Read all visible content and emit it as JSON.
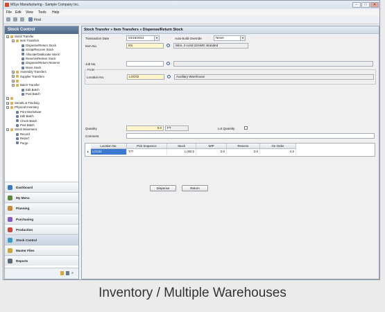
{
  "window": {
    "title": "MSys Manufacturing - Sample Company Inc.",
    "controls": [
      "–",
      "□",
      "✕"
    ]
  },
  "menu": [
    "File",
    "Edit",
    "View",
    "Tools",
    "Help"
  ],
  "toolbar": {
    "find_label": "Find"
  },
  "sidebar": {
    "header": "Stock Control",
    "tree": [
      {
        "label": "Stock Transfer",
        "lvl": 0,
        "exp": "−",
        "kind": "folder"
      },
      {
        "label": "Item Transfers",
        "lvl": 1,
        "exp": "−",
        "kind": "folder"
      },
      {
        "label": "Dispense/Return Stock",
        "lvl": 2,
        "kind": "leaf"
      },
      {
        "label": "Scrap/Recover Stock",
        "lvl": 2,
        "kind": "leaf"
      },
      {
        "label": "Allocate/Deallocate Stock",
        "lvl": 2,
        "kind": "leaf"
      },
      {
        "label": "Reserve/Relieve Stock",
        "lvl": 2,
        "kind": "leaf"
      },
      {
        "label": "Dispense/Return Reserve",
        "lvl": 2,
        "kind": "leaf"
      },
      {
        "label": "Move Stock",
        "lvl": 2,
        "kind": "leaf"
      },
      {
        "label": "Assembly Transfers",
        "lvl": 1,
        "exp": "+",
        "kind": "folder"
      },
      {
        "label": "Supplier Transfers",
        "lvl": 1,
        "exp": "+",
        "kind": "folder"
      },
      {
        "label": "",
        "lvl": 1,
        "exp": "+",
        "kind": "folder"
      },
      {
        "label": "Batch Transfer",
        "lvl": 1,
        "exp": "−",
        "kind": "folder"
      },
      {
        "label": "Edit Batch",
        "lvl": 2,
        "kind": "leaf"
      },
      {
        "label": "Post Batch",
        "lvl": 2,
        "kind": "leaf"
      },
      {
        "label": "",
        "lvl": 0,
        "exp": "+",
        "kind": "folder"
      },
      {
        "label": "Serial/Lot Tracking",
        "lvl": 0,
        "exp": "+",
        "kind": "folder"
      },
      {
        "label": "Physical Inventory",
        "lvl": 0,
        "exp": "−",
        "kind": "folder"
      },
      {
        "label": "Print Worksheet",
        "lvl": 1,
        "kind": "leaf"
      },
      {
        "label": "Edit Batch",
        "lvl": 1,
        "kind": "leaf"
      },
      {
        "label": "Check Batch",
        "lvl": 1,
        "kind": "leaf"
      },
      {
        "label": "Post Batch",
        "lvl": 1,
        "kind": "leaf"
      },
      {
        "label": "Stock Movement",
        "lvl": 0,
        "exp": "−",
        "kind": "folder"
      },
      {
        "label": "Record",
        "lvl": 1,
        "kind": "leaf"
      },
      {
        "label": "Report",
        "lvl": 1,
        "kind": "leaf"
      },
      {
        "label": "Purge",
        "lvl": 1,
        "kind": "leaf"
      }
    ],
    "nav": [
      {
        "label": "Dashboard",
        "color": "#3a78c9"
      },
      {
        "label": "My Menu",
        "color": "#5a8a3a"
      },
      {
        "label": "Planning",
        "color": "#c9873a"
      },
      {
        "label": "Purchasing",
        "color": "#8a5ac9"
      },
      {
        "label": "Production",
        "color": "#c94a3a"
      },
      {
        "label": "Stock Control",
        "color": "#3a9ac9"
      },
      {
        "label": "Master Files",
        "color": "#c9a93a"
      },
      {
        "label": "Reports",
        "color": "#5a6a7a"
      }
    ],
    "active_nav": 5
  },
  "main": {
    "breadcrumb": "Stock Transfer » Item Transfers » Dispense/Return Stock",
    "transaction_date_label": "Transaction Date",
    "transaction_date": "03/18/2014",
    "auto_build_label": "Auto-build Override",
    "auto_build_value": "Never",
    "item_no_label": "Item No.",
    "item_no": "I01",
    "item_desc": "Wire, 2-cond 22AWG stranded",
    "job_no_label": "Job No.",
    "job_no": "",
    "from_label": "From",
    "location_label": "Location No.",
    "location_no": "LOC02",
    "location_desc": "Auxiliary Warehouse",
    "quantity_label": "Quantity",
    "quantity": "0.0",
    "unit": "FT",
    "lot_qty_label": "Lot Quantity",
    "comment_label": "Comment",
    "comment": "",
    "grid": {
      "columns": [
        "Location No.",
        "Pick Sequence",
        "Stock",
        "WIP",
        "Reserve",
        "On Order"
      ],
      "rows": [
        [
          "LOC02",
          "T77",
          "1,000.0",
          "0.0",
          "0.0",
          "0.0"
        ]
      ]
    },
    "dispense_label": "Dispense",
    "return_label": "Return"
  },
  "caption": "Inventory / Multiple Warehouses"
}
